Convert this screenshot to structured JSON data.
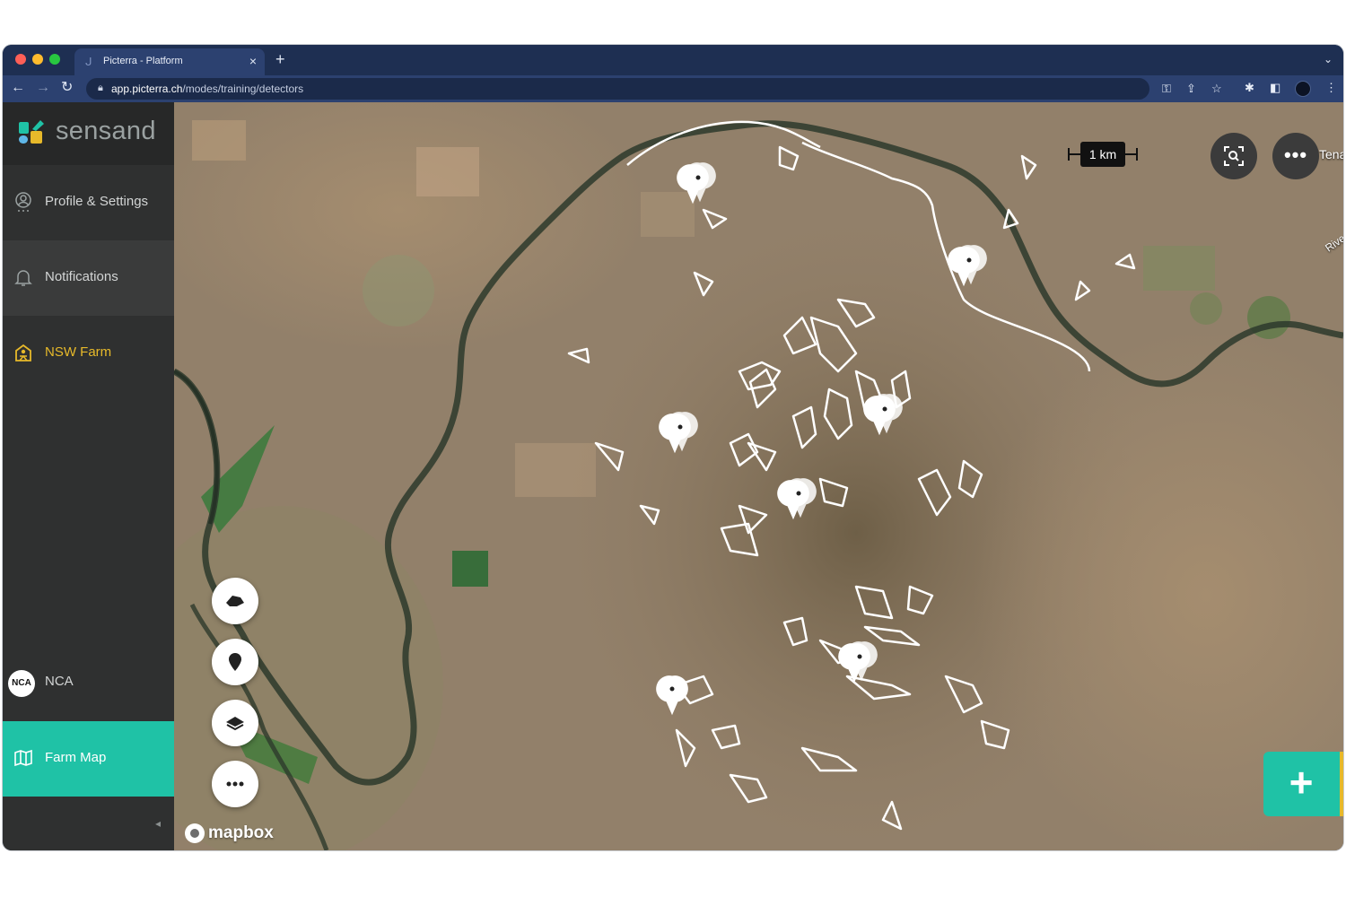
{
  "browser": {
    "tab_title": "Picterra - Platform",
    "tab_close": "×",
    "new_tab": "+",
    "tab_menu": "⌄",
    "url_host": "app.picterra.ch",
    "url_path": "/modes/training/detectors",
    "nav_back": "←",
    "nav_forward": "→",
    "nav_reload": "↻"
  },
  "app": {
    "brand": "sensand",
    "sidebar": {
      "profile": "Profile & Settings",
      "notifications": "Notifications",
      "farm": "NSW Farm",
      "nca_badge": "NCA",
      "nca": "NCA",
      "farm_map": "Farm Map",
      "collapse": "◂"
    }
  },
  "map": {
    "scale_label": "1 km",
    "place_label": "Tena",
    "river_label": "Rive",
    "attribution": "mapbox",
    "more": "•••",
    "add": "+"
  },
  "colors": {
    "accent": "#1fc2a6",
    "highlight": "#e7b92a",
    "sidebar": "#2f3030",
    "browser_chrome": "#2c4170"
  },
  "icons": [
    "profile-icon",
    "bell-icon",
    "farm-icon",
    "map-icon",
    "polygon-icon",
    "marker-icon",
    "layers-icon",
    "more-icon",
    "fit-bounds-icon",
    "plus-icon",
    "lock-icon",
    "key-icon",
    "share-icon",
    "star-icon",
    "extensions-icon",
    "sidepanel-icon"
  ]
}
